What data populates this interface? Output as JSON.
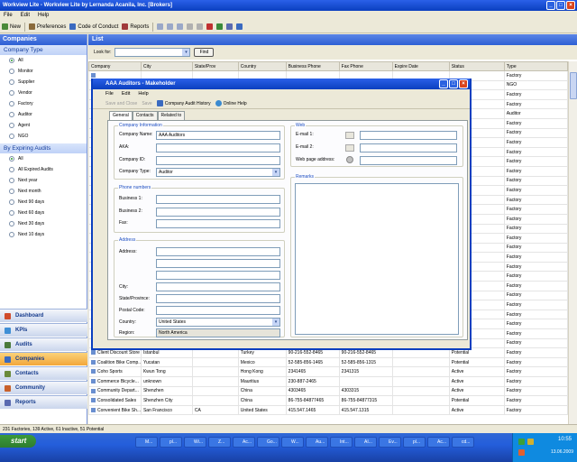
{
  "app": {
    "title": "Workview Lite - Workview Lite by Lernanda Acanila, Inc. [Brokers]",
    "menu": [
      "File",
      "Edit",
      "Help"
    ],
    "toolbar": {
      "new": "New",
      "preferences": "Preferences",
      "code_of_conduct": "Code of Conduct",
      "reports": "Reports"
    }
  },
  "sidebar": {
    "title": "Companies",
    "company_type": {
      "heading": "Company Type",
      "options": [
        "All",
        "Monitor",
        "Supplier",
        "Vendor",
        "Factory",
        "Auditor",
        "Agent",
        "NGO"
      ],
      "selected": "All"
    },
    "expiring": {
      "heading": "By Expiring Audits",
      "options": [
        "All",
        "All Expired Audits",
        "Next year",
        "Next month",
        "Next 90 days",
        "Next 60 days",
        "Next 30 days",
        "Next 10 days"
      ],
      "selected": "All"
    },
    "nav": [
      {
        "label": "Dashboard",
        "icon": "dashboard-icon",
        "color": "#d04c2c"
      },
      {
        "label": "KPIs",
        "icon": "kpi-icon",
        "color": "#3f8fd6"
      },
      {
        "label": "Audits",
        "icon": "audit-icon",
        "color": "#4a7a3a"
      },
      {
        "label": "Companies",
        "icon": "companies-icon",
        "color": "#3a6ac0",
        "active": true
      },
      {
        "label": "Contacts",
        "icon": "contacts-icon",
        "color": "#6a8a3a"
      },
      {
        "label": "Community",
        "icon": "community-icon",
        "color": "#c8602a"
      },
      {
        "label": "Reports",
        "icon": "reports-icon",
        "color": "#5a6ab0"
      }
    ]
  },
  "list": {
    "title": "List",
    "look_for_label": "Look for:",
    "find_label": "Find",
    "columns": [
      "Company",
      "City",
      "State/Prov",
      "Country",
      "Business Phone",
      "Fax Phone",
      "Expire Date",
      "Status",
      "Type"
    ],
    "rows_partial": [
      [
        "",
        "",
        "",
        "",
        "",
        "",
        "",
        "",
        "Factory"
      ],
      [
        "",
        "",
        "",
        "",
        "",
        "",
        "",
        "",
        "NGO"
      ],
      [
        "",
        "",
        "",
        "",
        "",
        "",
        "",
        "",
        "Factory"
      ],
      [
        "",
        "",
        "",
        "",
        "",
        "",
        "",
        "",
        "Factory"
      ],
      [
        "",
        "",
        "",
        "",
        "",
        "",
        "",
        "",
        "Auditor"
      ],
      [
        "",
        "",
        "",
        "",
        "",
        "",
        "",
        "",
        "Factory"
      ],
      [
        "",
        "",
        "",
        "",
        "",
        "",
        "",
        "",
        "Factory"
      ],
      [
        "",
        "",
        "",
        "",
        "",
        "",
        "",
        "",
        "Factory"
      ],
      [
        "",
        "",
        "",
        "",
        "",
        "",
        "",
        "",
        "Factory"
      ],
      [
        "",
        "",
        "",
        "",
        "",
        "",
        "",
        "",
        "Factory"
      ],
      [
        "",
        "",
        "",
        "",
        "",
        "",
        "",
        "",
        "Factory"
      ],
      [
        "",
        "",
        "",
        "",
        "",
        "",
        "",
        "",
        "Factory"
      ],
      [
        "",
        "",
        "",
        "",
        "",
        "",
        "",
        "",
        "Factory"
      ],
      [
        "",
        "",
        "",
        "",
        "",
        "",
        "",
        "",
        "Factory"
      ],
      [
        "",
        "",
        "",
        "",
        "",
        "",
        "",
        "",
        "Factory"
      ],
      [
        "",
        "",
        "",
        "",
        "",
        "",
        "",
        "",
        "Factory"
      ],
      [
        "",
        "",
        "",
        "",
        "",
        "",
        "",
        "",
        "Factory"
      ],
      [
        "",
        "",
        "",
        "",
        "",
        "",
        "",
        "",
        "Factory"
      ],
      [
        "",
        "",
        "",
        "",
        "",
        "",
        "",
        "",
        "Factory"
      ],
      [
        "",
        "",
        "",
        "",
        "",
        "",
        "",
        "",
        "Factory"
      ],
      [
        "",
        "",
        "",
        "",
        "",
        "",
        "",
        "",
        "Factory"
      ],
      [
        "",
        "",
        "",
        "",
        "",
        "",
        "",
        "",
        "Factory"
      ],
      [
        "",
        "",
        "",
        "",
        "",
        "",
        "",
        "",
        "Factory"
      ],
      [
        "",
        "",
        "",
        "",
        "",
        "",
        "",
        "",
        "Factory"
      ],
      [
        "",
        "",
        "",
        "",
        "",
        "",
        "",
        "",
        "Factory"
      ],
      [
        "",
        "",
        "",
        "",
        "",
        "",
        "",
        "",
        "Factory"
      ],
      [
        "",
        "",
        "",
        "",
        "",
        "",
        "",
        "",
        "Factory"
      ],
      [
        "",
        "",
        "",
        "",
        "",
        "",
        "",
        "",
        "Factory"
      ],
      [
        "",
        "",
        "",
        "",
        "",
        "",
        "",
        "",
        "Factory"
      ]
    ],
    "rows": [
      [
        "Client Discount Store",
        "Istanbul",
        "",
        "Turkey",
        "90-216-552-8465",
        "90-216-552-8465",
        "",
        "Potential",
        "Factory"
      ],
      [
        "Coalition Bike Comp...",
        "Yucatan",
        "",
        "Mexico",
        "52-585-856-1465",
        "52-585-856-1315",
        "",
        "Potential",
        "Factory"
      ],
      [
        "Coho Sports",
        "Kwun Tong",
        "",
        "Hong Kong",
        "2341465",
        "2341315",
        "",
        "Active",
        "Factory"
      ],
      [
        "Commerce Bicycle...",
        "unknown",
        "",
        "Mauritius",
        "230-887-2465",
        "",
        "",
        "Active",
        "Factory"
      ],
      [
        "Community Depart...",
        "Shenzhen",
        "",
        "China",
        "4303465",
        "4303315",
        "",
        "Active",
        "Factory"
      ],
      [
        "Consolidated Sales",
        "Shenzhen City",
        "",
        "China",
        "86-755-84877465",
        "86-755-84877315",
        "",
        "Potential",
        "Factory"
      ],
      [
        "Convenient Bike Sh...",
        "San Francisco",
        "CA",
        "United States",
        "415.547.1465",
        "415.547.1315",
        "",
        "Active",
        "Factory"
      ]
    ]
  },
  "status_text": "231 Factories, 139 Active, 61 Inactive, 51 Potential",
  "dialog": {
    "title": "AAA Auditors - Makeholder",
    "menu": [
      "File",
      "Edit",
      "Help"
    ],
    "toolbar": {
      "save_close": "Save and Close",
      "save": "Save",
      "audit_history": "Company Audit History",
      "online_help": "Online Help"
    },
    "tabs": [
      "General",
      "Contacts",
      "Related to"
    ],
    "company_info": {
      "legend": "Company Information",
      "name_label": "Company Name:",
      "name": "AAA Auditors",
      "aka_label": "AKA:",
      "aka": "",
      "id_label": "Company ID:",
      "id": "",
      "type_label": "Company Type:",
      "type": "Auditor"
    },
    "web": {
      "legend": "Web",
      "email1_label": "E-mail 1:",
      "email2_label": "E-mail 2:",
      "web_label": "Web page address:"
    },
    "phones": {
      "legend": "Phone numbers",
      "business1_label": "Business 1:",
      "business2_label": "Business 2:",
      "fax_label": "Fax:"
    },
    "remarks": {
      "legend": "Remarks"
    },
    "address": {
      "legend": "Address",
      "address_label": "Address:",
      "city_label": "City:",
      "state_label": "State/Province:",
      "postal_label": "Postal Code:",
      "country_label": "Country:",
      "country": "United States",
      "region_label": "Region:",
      "region": "North America"
    }
  },
  "taskbar": {
    "start": "start",
    "tasks": [
      "M...",
      "pl...",
      "Wi...",
      "Z...",
      "Ac...",
      "Go...",
      "W...",
      "Au...",
      "Int...",
      "AI...",
      "Ev...",
      "pl...",
      "Ac...",
      "cd..."
    ],
    "time": "10:55",
    "date": "13.06.2009"
  },
  "colors": {
    "accent": "#0a3fbf",
    "active_nav": "#f2a63a",
    "panel_head": "#2d5fd4"
  }
}
